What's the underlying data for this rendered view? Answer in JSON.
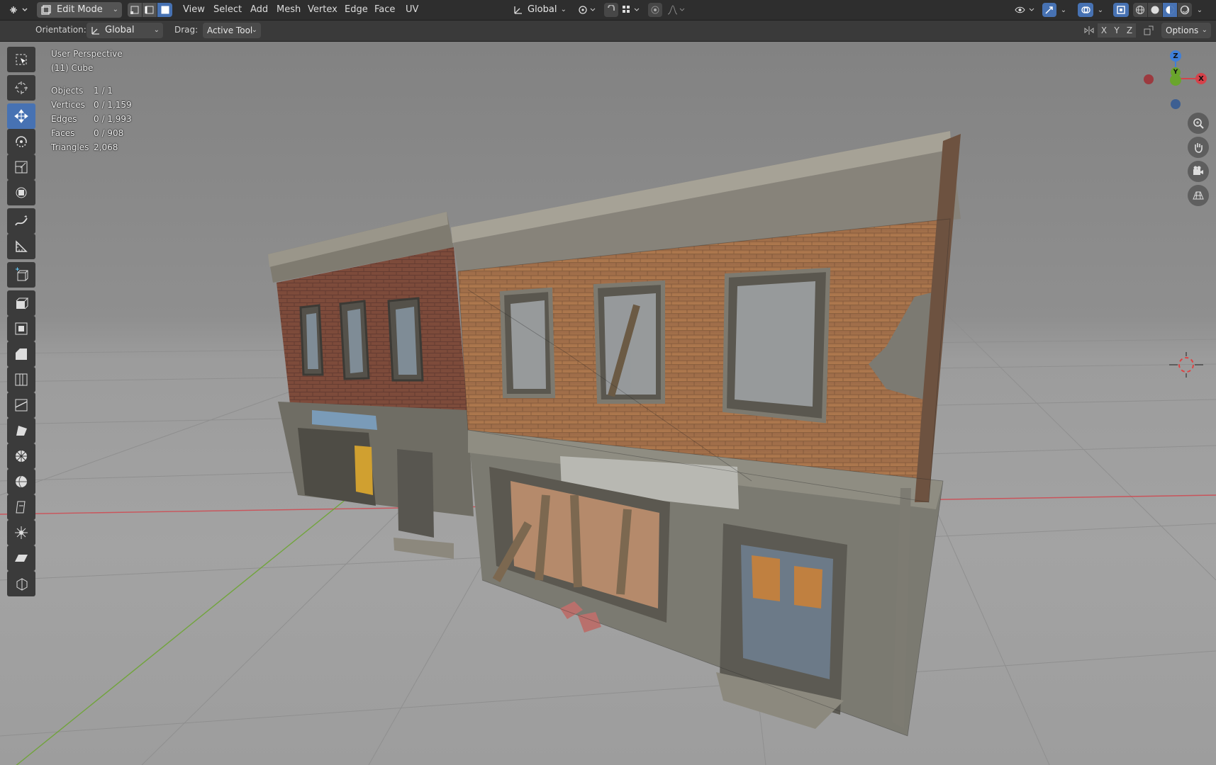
{
  "header": {
    "mode_label": "Edit Mode",
    "menus": [
      "View",
      "Select",
      "Add",
      "Mesh",
      "Vertex",
      "Edge",
      "Face",
      "UV"
    ],
    "transform_space": "Global"
  },
  "tool_settings": {
    "orientation_label": "Orientation:",
    "orientation_value": "Global",
    "drag_label": "Drag:",
    "drag_value": "Active Tool",
    "axis_x": "X",
    "axis_y": "Y",
    "axis_z": "Z",
    "options_label": "Options"
  },
  "viewport": {
    "view_name": "User Perspective",
    "object_name": "(11) Cube",
    "stats": [
      {
        "label": "Objects",
        "value": "1 / 1"
      },
      {
        "label": "Vertices",
        "value": "0 / 1,159"
      },
      {
        "label": "Edges",
        "value": "0 / 1,993"
      },
      {
        "label": "Faces",
        "value": "0 / 908"
      },
      {
        "label": "Triangles",
        "value": "2,068"
      }
    ]
  },
  "gizmo": {
    "z": "Z",
    "y": "Y",
    "x": "X"
  },
  "colors": {
    "active_tool": "#4772b3",
    "axis_red": "#d4424a",
    "axis_green": "#6aa52c",
    "axis_blue": "#3f7fd8",
    "selected_mode": "#4772b3"
  },
  "tools": [
    "select-box-icon",
    "cursor-icon",
    "move-icon",
    "rotate-icon",
    "scale-icon",
    "transform-icon",
    "annotate-icon",
    "measure-icon",
    "add-cube-icon",
    "extrude-icon",
    "inset-icon",
    "bevel-icon",
    "loop-cut-icon",
    "knife-icon",
    "poly-build-icon",
    "spin-icon",
    "smooth-icon",
    "edge-slide-icon",
    "shrink-fatten-icon",
    "shear-icon",
    "rip-icon"
  ]
}
